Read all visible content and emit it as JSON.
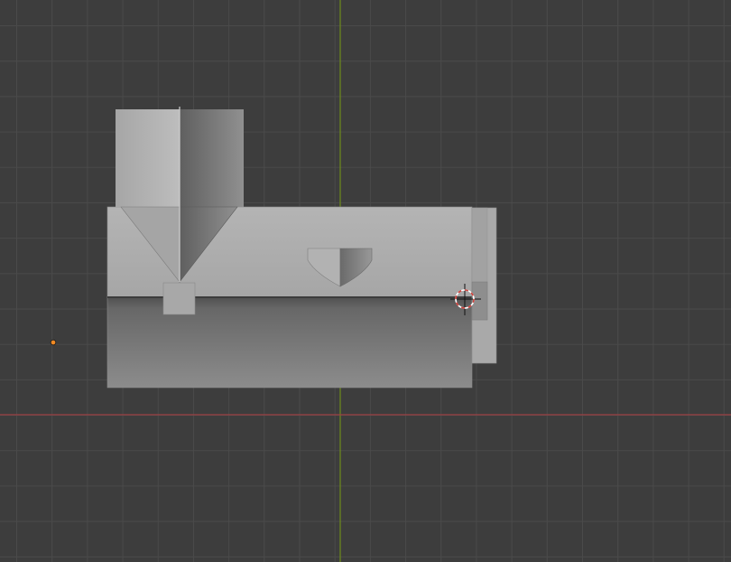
{
  "viewport": {
    "background_color": "#3d3d3d",
    "grid_color": "#4a4a4a",
    "x_axis_color": "#9c4043",
    "y_axis_color": "#6e8b1b",
    "origin_marker_color": "#f08a24",
    "cursor_ring_colors": [
      "#d0403a",
      "#ffffff"
    ]
  },
  "scene_object": {
    "shading": "solid",
    "base_color": "#9a9a9a",
    "light_color": "#b8b8b8",
    "dark_color": "#5a5a5a"
  },
  "icons": {
    "cursor": "3d-cursor-icon",
    "origin": "object-origin-icon"
  }
}
